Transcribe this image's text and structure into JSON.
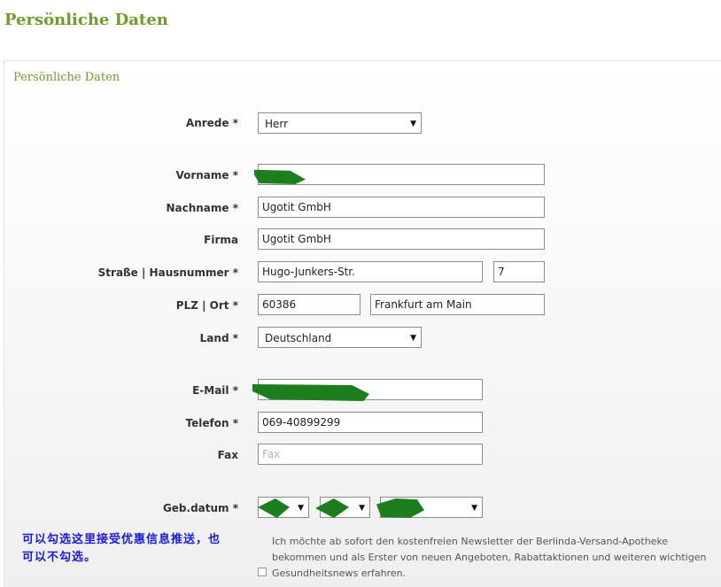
{
  "page": {
    "title": "Persönliche Daten"
  },
  "panel": {
    "title": "Persönliche Daten"
  },
  "form": {
    "anrede": {
      "label": "Anrede *",
      "value": "Herr"
    },
    "vorname": {
      "label": "Vorname *",
      "value": ""
    },
    "nachname": {
      "label": "Nachname *",
      "value": "Ugotit GmbH"
    },
    "firma": {
      "label": "Firma",
      "value": "Ugotit GmbH"
    },
    "strasse": {
      "label": "Straße | Hausnummer *",
      "street": "Hugo-Junkers-Str.",
      "number": "7"
    },
    "plz_ort": {
      "label": "PLZ | Ort *",
      "plz": "60386",
      "ort": "Frankfurt am Main"
    },
    "land": {
      "label": "Land *",
      "value": "Deutschland"
    },
    "email": {
      "label": "E-Mail *",
      "value": ""
    },
    "telefon": {
      "label": "Telefon *",
      "value": "069-40899299"
    },
    "fax": {
      "label": "Fax",
      "value": "",
      "placeholder": "Fax"
    },
    "geburtsdatum": {
      "label": "Geb.datum *"
    }
  },
  "annotation": {
    "text": "可以勾选这里接受优惠信息推送，也可以不勾选。"
  },
  "newsletter": {
    "text": "Ich möchte ab sofort den kostenfreien Newsletter der Berlinda-Versand-Apotheke bekommen und als Erster von neuen Angeboten, Rabattaktionen und weiteren wichtigen Gesundheitsnews erfahren.",
    "checked": false
  },
  "colors": {
    "accent_green": "#6e9c2d",
    "redaction": "#1c7e1c",
    "annotation_blue": "#1a1adf"
  },
  "icons": {
    "select_arrow": "dropdown-arrow-icon"
  }
}
